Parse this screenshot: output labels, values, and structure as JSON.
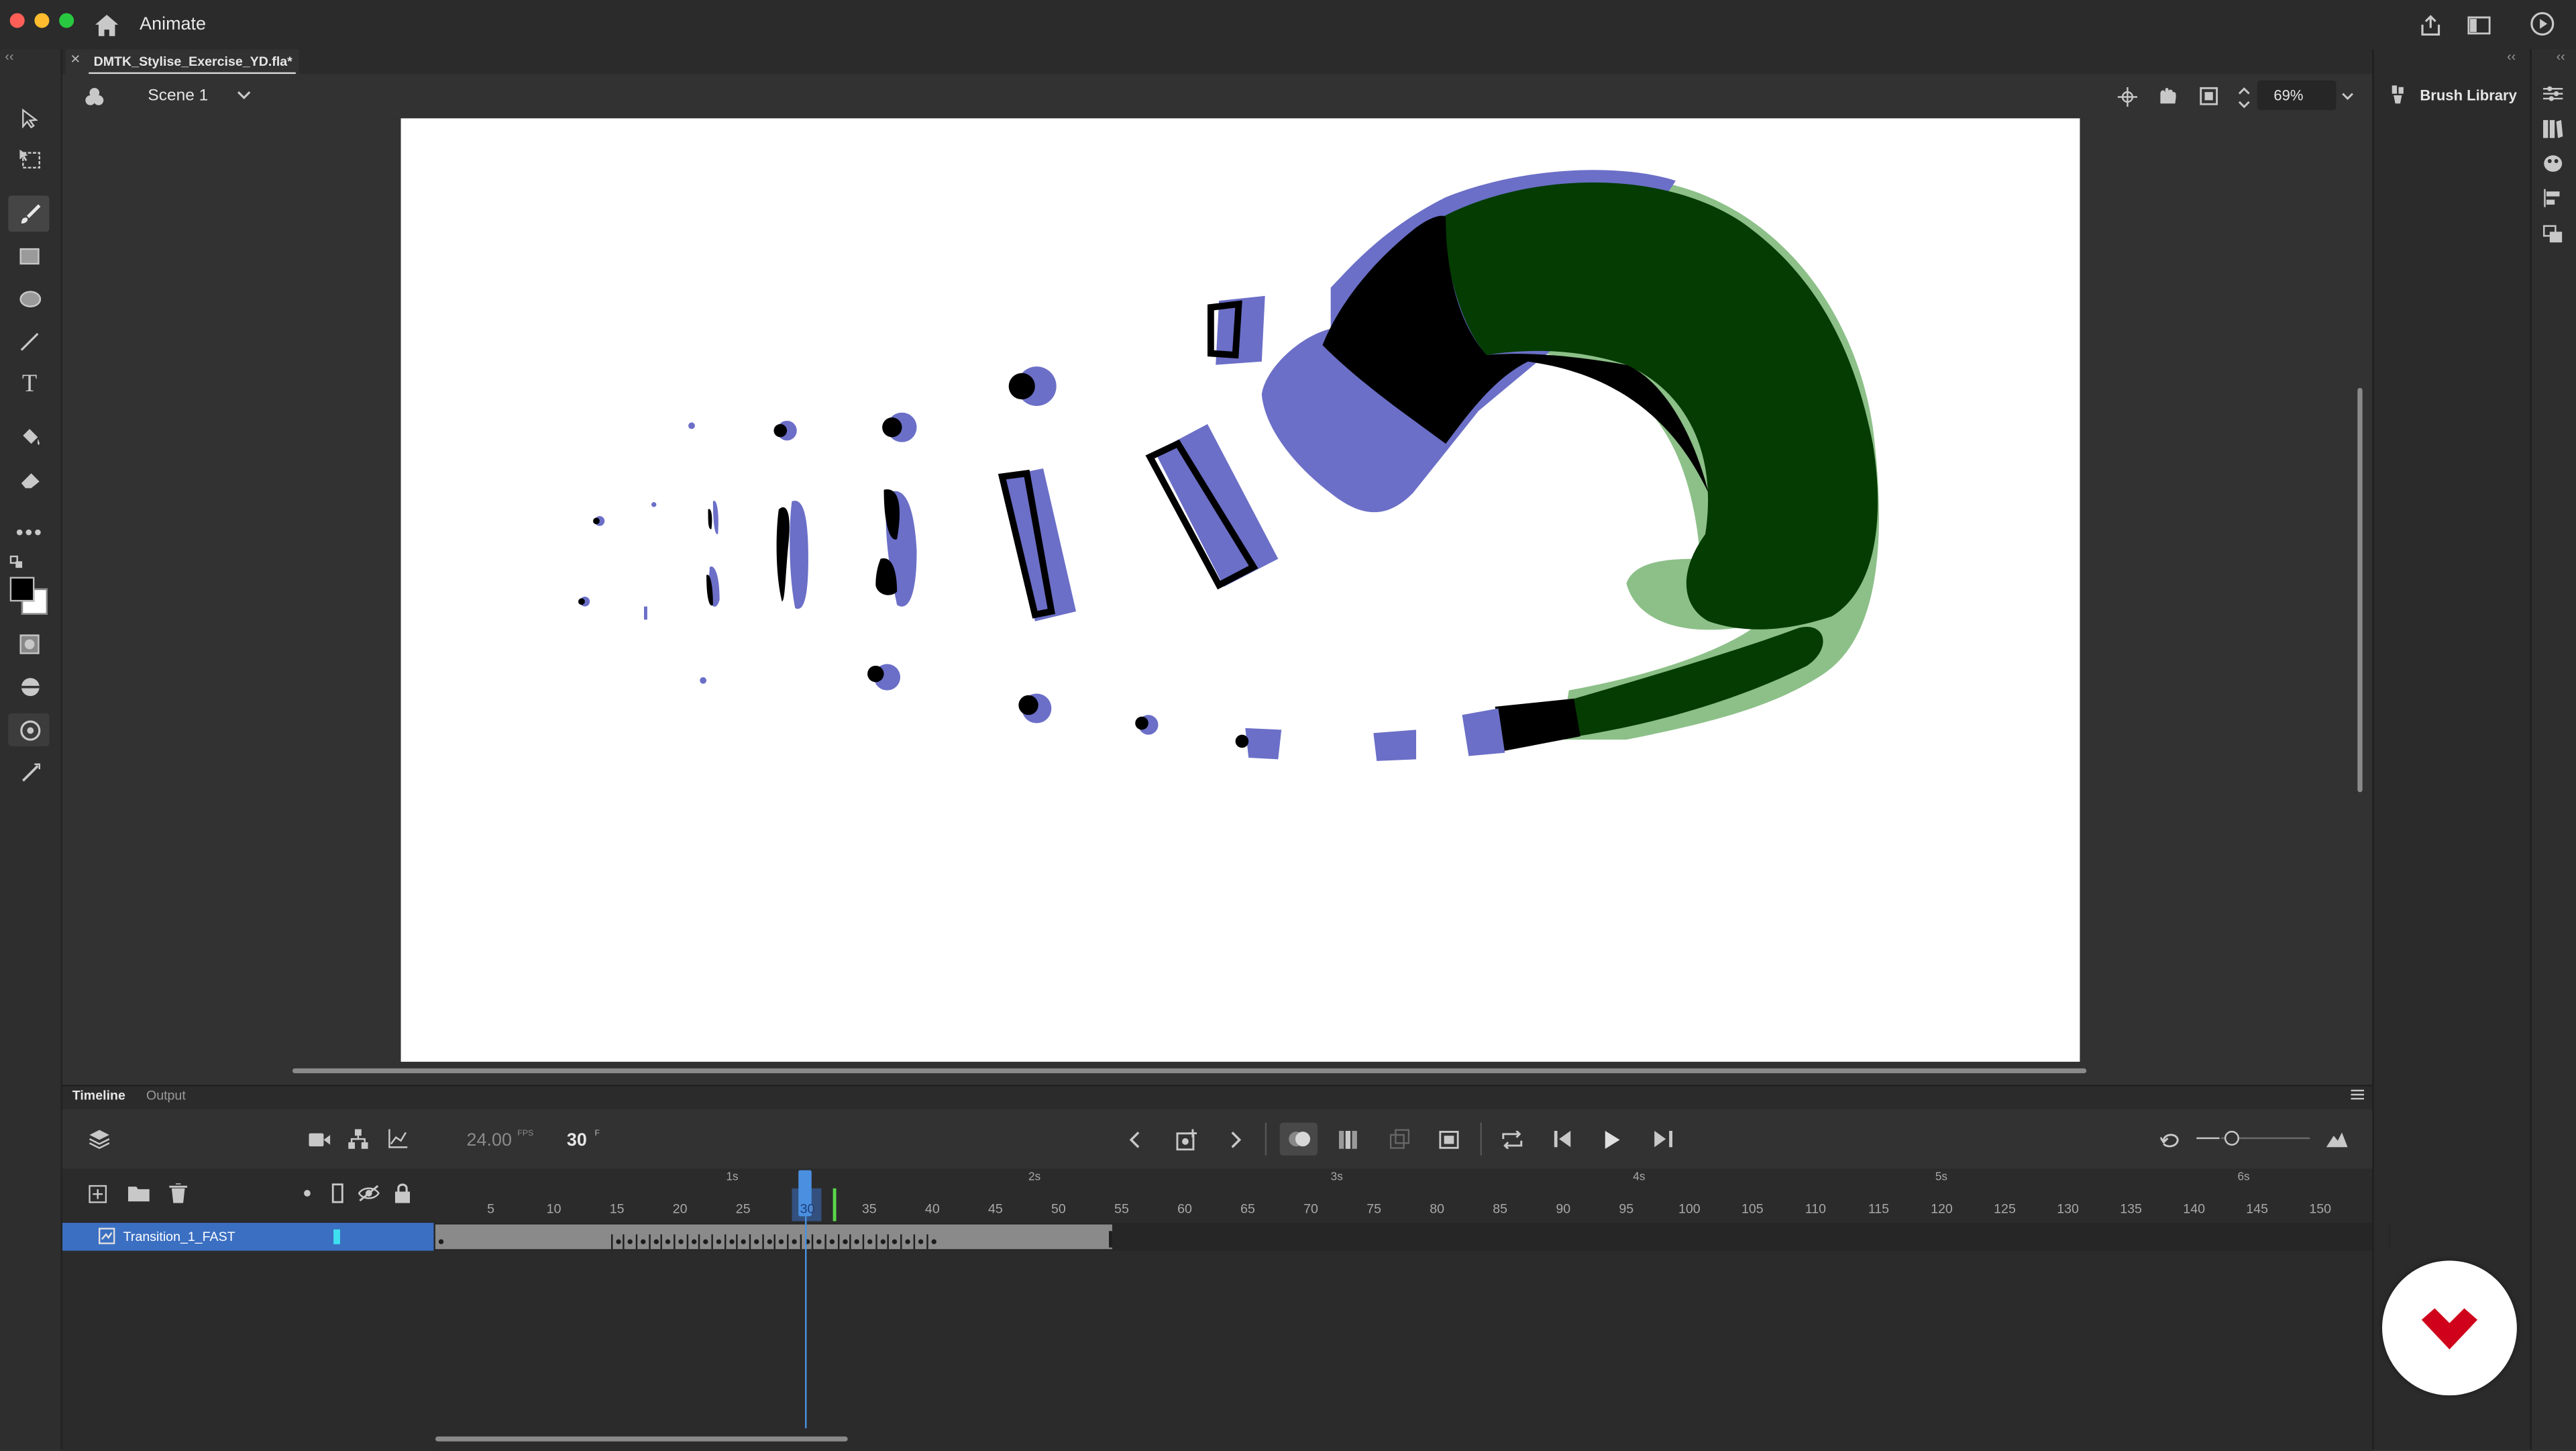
{
  "app": {
    "name": "Animate",
    "window_buttons": [
      "close",
      "minimize",
      "maximize"
    ]
  },
  "document": {
    "tab_title": "DMTK_Stylise_Exercise_YD.fla*",
    "scene": "Scene 1",
    "zoom": "69%"
  },
  "panels": {
    "brush_library": "Brush Library"
  },
  "timeline": {
    "tabs": [
      "Timeline",
      "Output"
    ],
    "fps": "24.00",
    "fps_unit": "FPS",
    "frame": "30",
    "frame_unit": "F",
    "current_frame": 30,
    "frame_ticks": [
      "5",
      "10",
      "15",
      "20",
      "25",
      "30",
      "35",
      "40",
      "45",
      "50",
      "55",
      "60",
      "65",
      "70",
      "75",
      "80",
      "85",
      "90",
      "95",
      "100",
      "105",
      "110",
      "115",
      "120",
      "125",
      "130",
      "135",
      "140",
      "145",
      "150"
    ],
    "second_markers": [
      "1s",
      "2s",
      "3s",
      "4s",
      "5s",
      "6s"
    ],
    "layers": [
      {
        "name": "Transition_1_FAST",
        "color": "#3ee0f0",
        "selected": true,
        "span_end_frame": 54
      }
    ]
  },
  "toolbar_left_icons": [
    "selection-tool-icon",
    "free-transform-tool-icon",
    "brush-tool-icon",
    "rectangle-tool-icon",
    "oval-tool-icon",
    "line-tool-icon",
    "text-tool-icon",
    "paint-bucket-tool-icon",
    "eraser-tool-icon",
    "more-tools-icon",
    "stroke-color-icon",
    "fill-color-icon",
    "object-drawing-icon",
    "width-tool-icon",
    "snap-icon",
    "pressure-icon"
  ],
  "colors": {
    "accent_blue": "#3b6fc2",
    "playhead": "#4a8fe0",
    "shape_purple": "#6b6fc7",
    "shape_dark_green": "#043c02",
    "shape_light_green": "#8cc088",
    "brand_red": "#d0021b"
  }
}
